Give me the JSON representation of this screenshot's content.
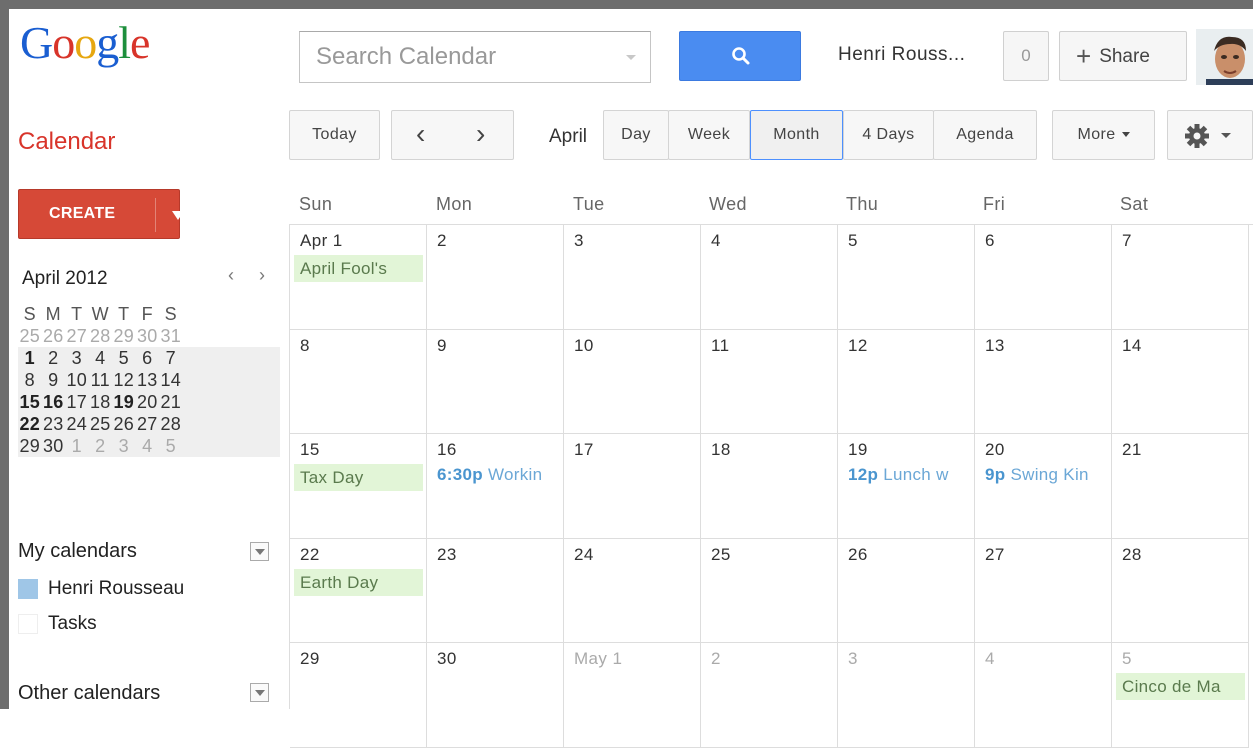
{
  "header": {
    "logo": [
      "G",
      "o",
      "o",
      "g",
      "l",
      "e"
    ],
    "search_placeholder": "Search Calendar",
    "user_name": "Henri Rouss...",
    "notifications": "0",
    "share_label": "Share"
  },
  "app_name": "Calendar",
  "create_label": "CREATE",
  "mini_calendar": {
    "title": "April 2012",
    "prev": "‹",
    "next": "›",
    "weekdays": [
      "S",
      "M",
      "T",
      "W",
      "T",
      "F",
      "S"
    ],
    "weeks": [
      [
        "25",
        "26",
        "27",
        "28",
        "29",
        "30",
        "31"
      ],
      [
        "1",
        "2",
        "3",
        "4",
        "5",
        "6",
        "7"
      ],
      [
        "8",
        "9",
        "10",
        "11",
        "12",
        "13",
        "14"
      ],
      [
        "15",
        "16",
        "17",
        "18",
        "19",
        "20",
        "21"
      ],
      [
        "22",
        "23",
        "24",
        "25",
        "26",
        "27",
        "28"
      ],
      [
        "29",
        "30",
        "1",
        "2",
        "3",
        "4",
        "5"
      ]
    ]
  },
  "sections": {
    "my_calendars": "My calendars",
    "other_calendars": "Other calendars"
  },
  "calendars": [
    {
      "name": "Henri Rousseau",
      "color": "#9fc6e7"
    },
    {
      "name": "Tasks",
      "color": "#ffffff"
    }
  ],
  "toolbar": {
    "today": "Today",
    "prev": "‹",
    "next": "›",
    "month_label": "April",
    "views": [
      "Day",
      "Week",
      "Month",
      "4 Days",
      "Agenda"
    ],
    "more": "More",
    "selected_view": "Month"
  },
  "weekdays": [
    "Sun",
    "Mon",
    "Tue",
    "Wed",
    "Thu",
    "Fri",
    "Sat"
  ],
  "weeks": [
    [
      {
        "label": "Apr 1",
        "chip": "April Fool's"
      },
      {
        "label": "2"
      },
      {
        "label": "3"
      },
      {
        "label": "4"
      },
      {
        "label": "5"
      },
      {
        "label": "6"
      },
      {
        "label": "7"
      }
    ],
    [
      {
        "label": "8"
      },
      {
        "label": "9"
      },
      {
        "label": "10"
      },
      {
        "label": "11"
      },
      {
        "label": "12"
      },
      {
        "label": "13"
      },
      {
        "label": "14"
      }
    ],
    [
      {
        "label": "15",
        "chip": "Tax Day"
      },
      {
        "label": "16",
        "event_time": "6:30p",
        "event_title": "Workin"
      },
      {
        "label": "17"
      },
      {
        "label": "18"
      },
      {
        "label": "19",
        "event_time": "12p",
        "event_title": "Lunch w"
      },
      {
        "label": "20",
        "event_time": "9p",
        "event_title": "Swing Kin"
      },
      {
        "label": "21"
      }
    ],
    [
      {
        "label": "22",
        "chip": "Earth Day"
      },
      {
        "label": "23"
      },
      {
        "label": "24"
      },
      {
        "label": "25"
      },
      {
        "label": "26"
      },
      {
        "label": "27"
      },
      {
        "label": "28"
      }
    ],
    [
      {
        "label": "29"
      },
      {
        "label": "30"
      },
      {
        "label": "May 1",
        "dim": true
      },
      {
        "label": "2",
        "dim": true
      },
      {
        "label": "3",
        "dim": true
      },
      {
        "label": "4",
        "dim": true
      },
      {
        "label": "5",
        "dim": true,
        "chip": "Cinco de Ma"
      }
    ]
  ],
  "colors": {
    "accent_red": "#d64937",
    "search_blue": "#4a8cf1",
    "holiday_chip": "#e2f5d7",
    "event_text": "#6ba7d6",
    "selected_border": "#4d90fe"
  },
  "icons": {
    "search": "search-icon",
    "gear": "gear-icon",
    "dropdown": "chevron-down-icon"
  }
}
